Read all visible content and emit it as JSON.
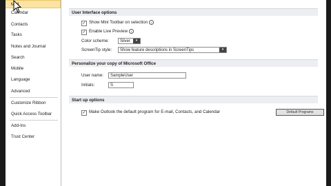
{
  "sidebar": {
    "items": [
      {
        "label": "Mail"
      },
      {
        "label": "Calendar"
      },
      {
        "label": "Contacts"
      },
      {
        "label": "Tasks"
      },
      {
        "label": "Notes and Journal"
      },
      {
        "label": "Search"
      },
      {
        "label": "Mobile"
      },
      {
        "label": "Language"
      },
      {
        "label": "Advanced"
      },
      {
        "label": "Customize Ribbon"
      },
      {
        "label": "Quick Access Toolbar"
      },
      {
        "label": "Add-Ins"
      },
      {
        "label": "Trust Center"
      }
    ]
  },
  "ui_options": {
    "header": "User Interface options",
    "mini_toolbar_label": "Show Mini Toolbar on selection",
    "live_preview_label": "Enable Live Preview",
    "color_scheme_label": "Color scheme:",
    "color_scheme_value": "Silver",
    "screentip_label": "ScreenTip style:",
    "screentip_value": "Show feature descriptions in ScreenTips"
  },
  "personalize": {
    "header": "Personalize your copy of Microsoft Office",
    "user_name_label": "User name:",
    "user_name_value": "SampleUser",
    "initials_label": "Initials:",
    "initials_value": "S"
  },
  "startup": {
    "header": "Start up options",
    "default_program_label": "Make Outlook the default program for E-mail, Contacts, and Calendar",
    "default_programs_button": "Default Programs"
  }
}
